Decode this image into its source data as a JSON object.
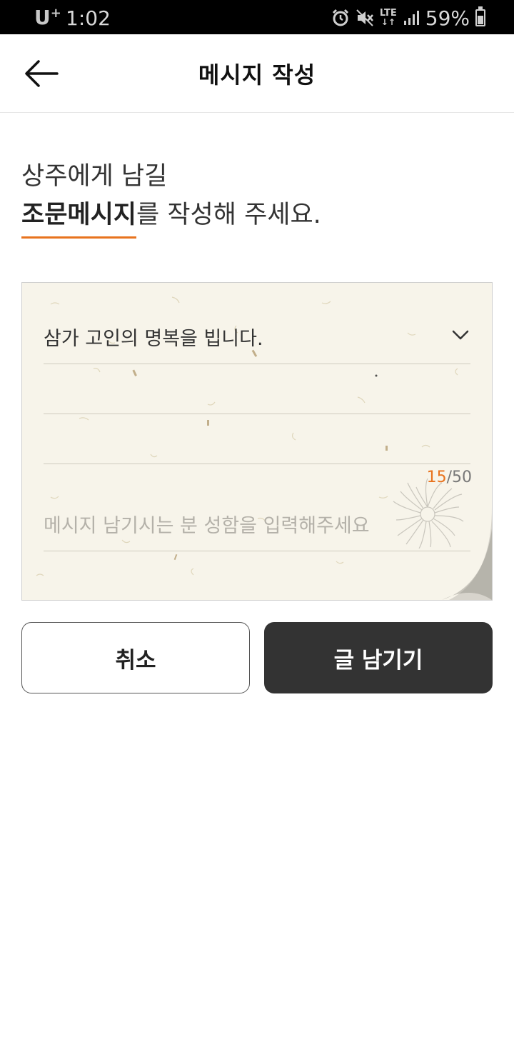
{
  "status_bar": {
    "carrier": "U",
    "carrier_mark": "+",
    "time": "1:02",
    "network": "LTE",
    "battery_percent": "59%",
    "icons": [
      "alarm-icon",
      "mute-icon",
      "lte-icon",
      "signal-icon",
      "battery-icon"
    ]
  },
  "header": {
    "title": "메시지 작성",
    "back_icon": "arrow-left-icon"
  },
  "intro": {
    "line1": "상주에게 남길",
    "emphasis": "조문메시지",
    "line2_rest": "를 작성해 주세요."
  },
  "message_card": {
    "selected_message": "삼가 고인의 명복을 빕니다.",
    "char_count_current": "15",
    "char_count_separator": "/",
    "char_count_max": "50",
    "name_placeholder": "메시지 남기시는 분 성함을 입력해주세요",
    "name_value": ""
  },
  "actions": {
    "cancel_label": "취소",
    "submit_label": "글 남기기"
  },
  "colors": {
    "accent": "#e8731e",
    "submit_bg": "#333333",
    "paper_bg": "#f7f4ea"
  }
}
